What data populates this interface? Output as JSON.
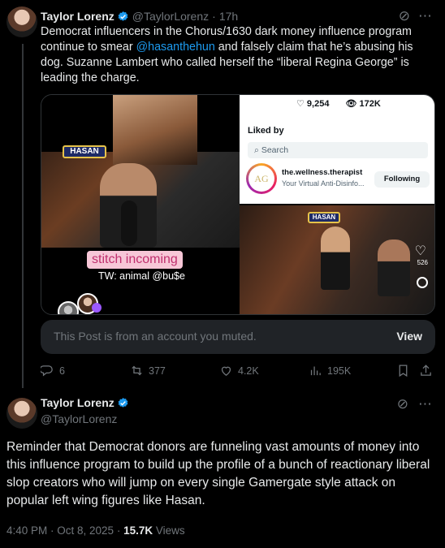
{
  "post1": {
    "author_name": "Taylor Lorenz",
    "handle": "@TaylorLorenz",
    "time": "17h",
    "text_before": "Democrat influencers in the Chorus/1630 dark money influence program continue to smear ",
    "mention": "@hasanthehun",
    "text_after": " and falsely claim that he’s abusing his dog. Suzanne Lambert who called herself the “liberal Regina George” is leading the charge.",
    "media": {
      "left_logo": "HASAN",
      "stitch_text": "stitch incoming",
      "tw_text": "TW: animal @bu$e",
      "screenshot": {
        "likes": "9,254",
        "views": "172K",
        "liked_by": "Liked by",
        "search_placeholder": "Search",
        "account_name": "the.wellness.therapist",
        "account_sub": "Your Virtual Anti-Disinfo...",
        "follow_label": "Following"
      },
      "video": {
        "logo": "HASAN",
        "like_count": "526"
      }
    },
    "muted_notice": "This Post is from an account you muted.",
    "view_label": "View",
    "replies": "6",
    "reposts": "377",
    "likes": "4.2K",
    "views": "195K"
  },
  "post2": {
    "author_name": "Taylor Lorenz",
    "handle": "@TaylorLorenz",
    "text": "Reminder that Democrat donors are funneling vast amounts of money into this influence program to build up the profile of a bunch of reactionary liberal slop creators who will jump on every single Gamergate style attack on popular left wing figures like Hasan.",
    "timestamp": "4:40 PM · Oct 8, 2025 · ",
    "view_count": "15.7K",
    "views_label": " Views"
  },
  "colors": {
    "background": "#000000",
    "text": "#e7e9ea",
    "muted": "#71767b",
    "accent": "#1d9bf0"
  }
}
